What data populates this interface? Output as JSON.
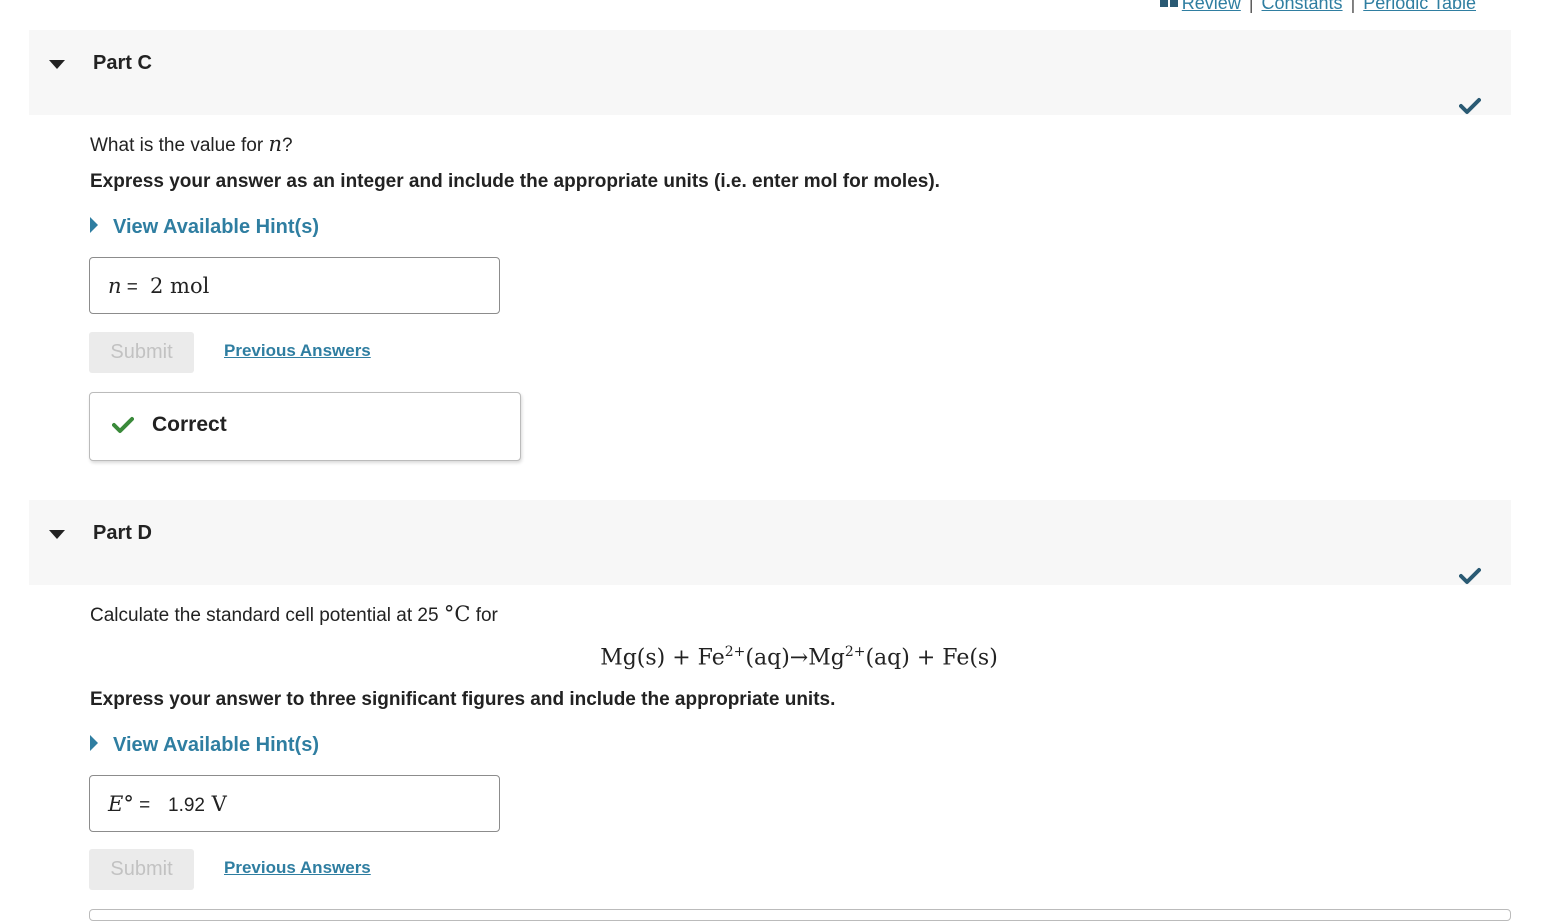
{
  "top_links": {
    "review": "Review",
    "constants": "Constants",
    "periodic_table": "Periodic Table",
    "separator": "|"
  },
  "colors": {
    "link": "#2f7ea1",
    "check_dark": "#2a5a73",
    "check_green": "#3a8a3a",
    "header_bg": "#f7f7f7"
  },
  "part_c": {
    "title": "Part C",
    "question_prefix": "What is the value for ",
    "question_var": "n",
    "question_suffix": "?",
    "instruction": "Express your answer as an integer and include the appropriate units (i.e. enter mol for moles).",
    "hint_label": "View Available Hint(s)",
    "answer_label_var": "n",
    "answer_label_eq": " =",
    "answer_value": "2 mol",
    "submit_label": "Submit",
    "previous_answers_label": "Previous Answers",
    "feedback": "Correct"
  },
  "part_d": {
    "title": "Part D",
    "question_prefix": "Calculate the standard cell potential at 25 ",
    "question_unit": "°C",
    "question_suffix": " for",
    "equation": {
      "left1": "Mg(s) + Fe",
      "charge1": "2+",
      "left2": "(aq)→Mg",
      "charge2": "2+",
      "right": "(aq) + Fe(s)"
    },
    "instruction": "Express your answer to three significant figures and include the appropriate units.",
    "hint_label": "View Available Hint(s)",
    "answer_label_var": "E°",
    "answer_label_eq": " = ",
    "answer_number": "1.92",
    "answer_unit": " V",
    "submit_label": "Submit",
    "previous_answers_label": "Previous Answers"
  }
}
